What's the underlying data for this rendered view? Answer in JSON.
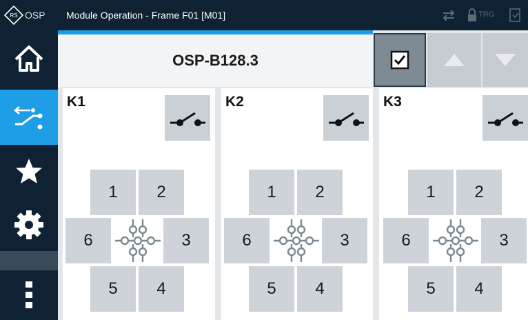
{
  "titlebar": {
    "app_short": "OSP",
    "title": "Module Operation - Frame F01 [M01]",
    "trg_label": "TRG"
  },
  "nav": {
    "items": [
      {
        "name": "home",
        "icon": "home-icon"
      },
      {
        "name": "switch",
        "icon": "switch-icon",
        "active": true
      },
      {
        "name": "favorites",
        "icon": "star-icon"
      },
      {
        "name": "settings",
        "icon": "gear-icon"
      },
      {
        "name": "more",
        "icon": "vertical-dots-icon"
      }
    ]
  },
  "header": {
    "module_name": "OSP-B128.3",
    "buttons": [
      {
        "name": "check",
        "icon": "checkbox-icon"
      },
      {
        "name": "up",
        "icon": "triangle-up-icon"
      },
      {
        "name": "down",
        "icon": "triangle-down-icon"
      }
    ]
  },
  "relays": [
    {
      "name": "K1",
      "ports": {
        "top_left": "1",
        "top_right": "2",
        "left": "6",
        "right": "3",
        "bottom_left": "5",
        "bottom_right": "4"
      }
    },
    {
      "name": "K2",
      "ports": {
        "top_left": "1",
        "top_right": "2",
        "left": "6",
        "right": "3",
        "bottom_left": "5",
        "bottom_right": "4"
      }
    },
    {
      "name": "K3",
      "ports": {
        "top_left": "1",
        "top_right": "2",
        "left": "6",
        "right": "3",
        "bottom_left": "5",
        "bottom_right": "4"
      }
    }
  ],
  "colors": {
    "nav_bg": "#0e2233",
    "accent": "#1e9ee6",
    "port_bg": "#cdd3d8",
    "hub_stroke": "#7a8891"
  }
}
